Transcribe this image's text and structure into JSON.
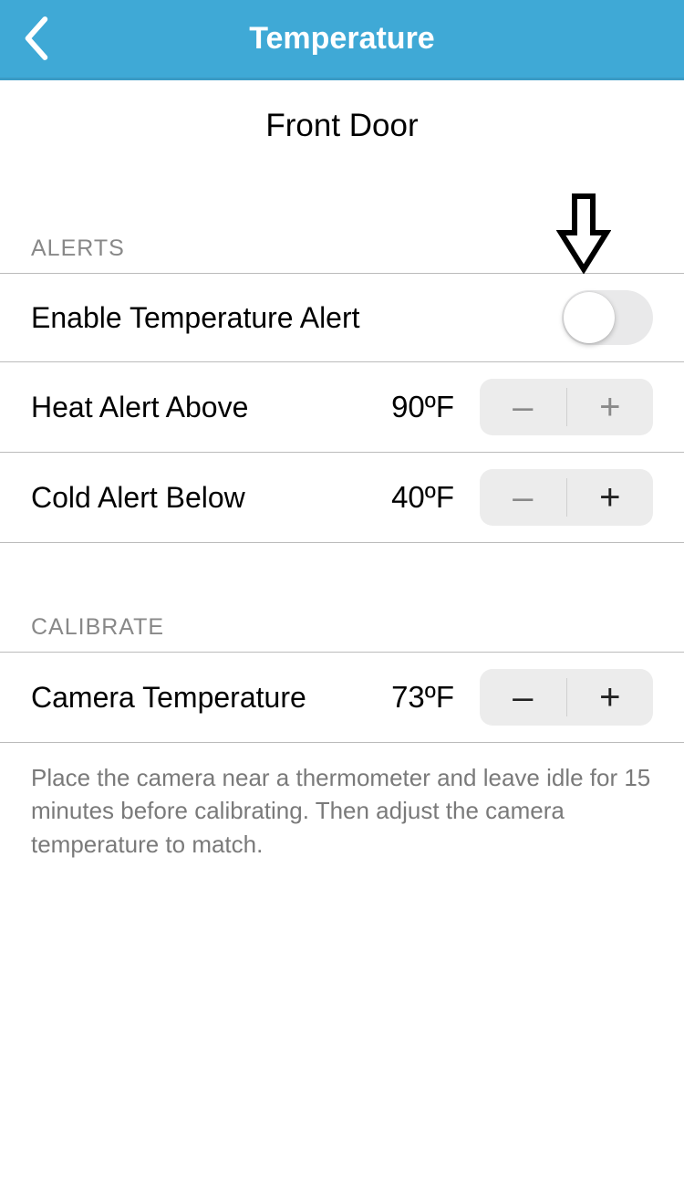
{
  "header": {
    "title": "Temperature"
  },
  "device": {
    "name": "Front Door"
  },
  "sections": {
    "alerts": {
      "header": "ALERTS",
      "enable": {
        "label": "Enable Temperature Alert",
        "on": false
      },
      "heat": {
        "label": "Heat Alert Above",
        "value": "90",
        "unit": "ºF"
      },
      "cold": {
        "label": "Cold Alert Below",
        "value": "40",
        "unit": "ºF"
      }
    },
    "calibrate": {
      "header": "CALIBRATE",
      "camera": {
        "label": "Camera Temperature",
        "value": "73",
        "unit": "ºF"
      },
      "note": "Place the camera near a thermometer and leave idle for 15 minutes before calibrating. Then adjust the camera temperature to match."
    }
  },
  "glyphs": {
    "minus": "–",
    "plus": "+"
  }
}
